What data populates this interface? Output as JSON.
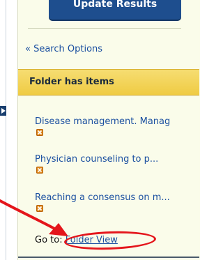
{
  "panel": {
    "update_button_label": "Update Results",
    "search_options_link": "« Search Options",
    "folder_header": "Folder has items",
    "folder_items": [
      {
        "label": "Disease management. Manag"
      },
      {
        "label": "Physician counseling to p..."
      },
      {
        "label": "Reaching a consensus on m..."
      }
    ],
    "goto_prefix": "Go to:",
    "goto_link": "Folder View"
  },
  "colors": {
    "accent_blue": "#1e4e8e",
    "link_blue": "#1a4fa0",
    "header_yellow": "#efcb43",
    "annotation_red": "#e4151b",
    "panel_background": "#fafcea"
  },
  "icons": {
    "collapse_toggle": "triangle-right-icon",
    "remove_item": "orange-x-icon"
  }
}
